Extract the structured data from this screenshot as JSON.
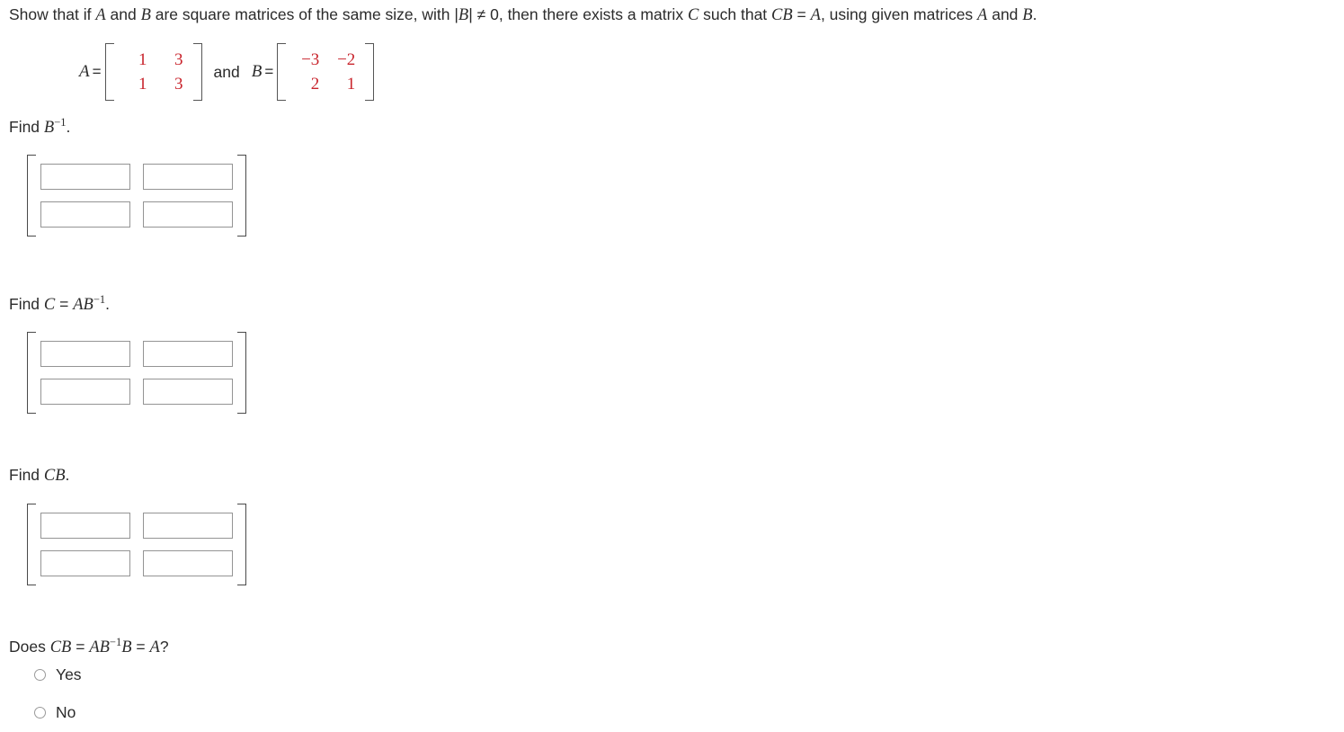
{
  "problem": {
    "statement_part1": "Show that if ",
    "var_A": "A",
    "statement_part2": " and ",
    "var_B": "B",
    "statement_part3": " are square matrices of the same size, with |",
    "var_B2": "B",
    "statement_part4": "| ≠ 0, then there exists a matrix ",
    "var_C": "C",
    "statement_part5": " such that ",
    "var_CB": "CB",
    "statement_part6": " = ",
    "var_A2": "A",
    "statement_part7": ", using given matrices ",
    "var_A3": "A",
    "statement_part8": " and ",
    "var_B3": "B",
    "statement_part9": "."
  },
  "given": {
    "label_A": "A",
    "equals": "=",
    "matrix_A": [
      [
        "1",
        "3"
      ],
      [
        "1",
        "3"
      ]
    ],
    "and_word": "and",
    "label_B": "B",
    "equals_b": "=",
    "matrix_B": [
      [
        "−3",
        "−2"
      ],
      [
        "2",
        "1"
      ]
    ],
    "value_color": "#c9252d"
  },
  "sections": [
    {
      "id": "find-b-inverse",
      "prefix": "Find ",
      "var": "B",
      "exponent": "−1",
      "suffix": ".",
      "inputs": [
        {
          "name": "b-inv-r1c1",
          "value": "",
          "placeholder": ""
        },
        {
          "name": "b-inv-r1c2",
          "value": "",
          "placeholder": ""
        },
        {
          "name": "b-inv-r2c1",
          "value": "",
          "placeholder": ""
        },
        {
          "name": "b-inv-r2c2",
          "value": "",
          "placeholder": ""
        }
      ]
    },
    {
      "id": "find-c",
      "prefix": "Find ",
      "var": "C",
      "middle": " = ",
      "var2": "AB",
      "exponent": "−1",
      "suffix": ".",
      "inputs": [
        {
          "name": "c-r1c1",
          "value": "",
          "placeholder": ""
        },
        {
          "name": "c-r1c2",
          "value": "",
          "placeholder": ""
        },
        {
          "name": "c-r2c1",
          "value": "",
          "placeholder": ""
        },
        {
          "name": "c-r2c2",
          "value": "",
          "placeholder": ""
        }
      ]
    },
    {
      "id": "find-cb",
      "prefix": "Find ",
      "var": "CB",
      "suffix": ".",
      "inputs": [
        {
          "name": "cb-r1c1",
          "value": "",
          "placeholder": ""
        },
        {
          "name": "cb-r1c2",
          "value": "",
          "placeholder": ""
        },
        {
          "name": "cb-r2c1",
          "value": "",
          "placeholder": ""
        },
        {
          "name": "cb-r2c2",
          "value": "",
          "placeholder": ""
        }
      ]
    }
  ],
  "final": {
    "q_prefix": "Does ",
    "q_cb": "CB",
    "q_eq1": " = ",
    "q_ab": "AB",
    "q_exp": "−1",
    "q_b": "B",
    "q_eq2": " = ",
    "q_a": "A",
    "q_mark": "?",
    "options": [
      {
        "label": "Yes",
        "selected": false
      },
      {
        "label": "No",
        "selected": false
      }
    ]
  }
}
